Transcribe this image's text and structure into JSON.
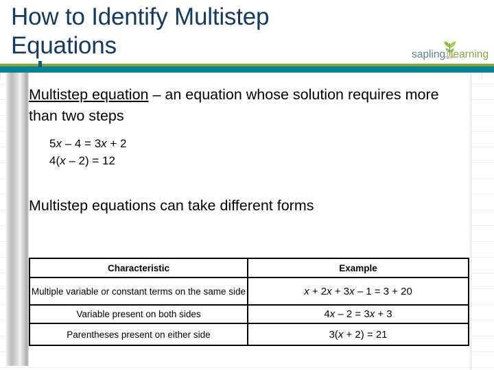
{
  "slide": {
    "title": "How to Identify Multistep\nEquations",
    "title_color": "#123a63",
    "band_green": "#7fa93c",
    "band_teal": "#068195"
  },
  "logo": {
    "word_one": "sapling",
    "word_two": "learning",
    "word_one_color": "#5b7f93",
    "word_two_color": "#7fa93c",
    "leaf_color": "#8cbf3f",
    "stem_color": "#6f9a33",
    "icon": "sapling-plant-icon"
  },
  "body": {
    "definition_term": "Multistep equation",
    "definition_rest": " – an equation whose solution requires more than two steps",
    "examples": [
      "5x – 4 = 3x + 2",
      "4(x – 2) = 12"
    ],
    "forms_heading": "Multistep equations can take different forms"
  },
  "table": {
    "headers": [
      "Characteristic",
      "Example"
    ],
    "rows": [
      {
        "characteristic": "Multiple variable or constant terms on the same side",
        "example": "x + 2x + 3x – 1 = 3 + 20"
      },
      {
        "characteristic": "Variable present on both sides",
        "example": "4x – 2 = 3x + 3"
      },
      {
        "characteristic": "Parentheses present on either side",
        "example": "3(x + 2) = 21"
      }
    ]
  }
}
